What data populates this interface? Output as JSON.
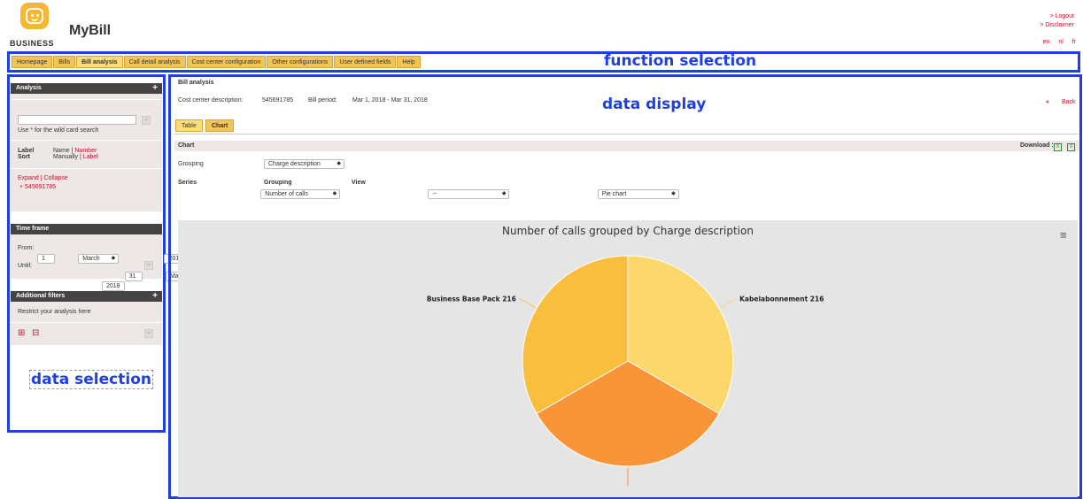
{
  "header": {
    "app_title": "MyBill",
    "brand_sub": "BUSINESS",
    "logout": "> Logout",
    "disclaimer": "> Disclaimer",
    "languages": [
      "en",
      "nl",
      "fr"
    ]
  },
  "annotations": {
    "function_selection": "function selection",
    "data_display": "data display",
    "data_selection": "data selection"
  },
  "nav": [
    "Homepage",
    "Bills",
    "Bill analysis",
    "Call detail analysis",
    "Cost center configuration",
    "Other configurations",
    "User defined fields",
    "Help"
  ],
  "left": {
    "analysis": {
      "title": "Analysis",
      "search_hint": "Use * for the wild card search",
      "label_key": "Label",
      "label_name": "Name",
      "label_sep": " | ",
      "label_number": "Number",
      "sort_key": "Sort",
      "sort_manual": "Manually",
      "sort_label": "Label",
      "expand": "Expand",
      "collapse": "Collapse",
      "tree_item": "+ 545691785"
    },
    "timeframe": {
      "title": "Time frame",
      "from_label": "From:",
      "from_day": "1",
      "from_month": "March",
      "from_year": "2018",
      "until_label": "Until:",
      "until_day": "31",
      "until_month": "March",
      "until_year": "2018"
    },
    "filters": {
      "title": "Additional filters",
      "restrict": "Restrict your analysis here"
    }
  },
  "main": {
    "title": "Bill analysis",
    "cc_label": "Cost center description:",
    "cc_value": "545691785",
    "period_label": "Bill period:",
    "period_value": "Mar 1, 2018 - Mar 31, 2018",
    "back": "Back",
    "tabs": [
      "Table",
      "Chart"
    ],
    "chart_section": "Chart",
    "download": "Download :",
    "grouping_label": "Grouping",
    "grouping_value": "Charge description",
    "series_label": "Series",
    "series_value": "Number of calls",
    "grouping2_label": "Grouping",
    "grouping2_value": "--",
    "view_label": "View",
    "view_value": "Pie chart"
  },
  "chart_data": {
    "type": "pie",
    "title": "Number of calls grouped by Charge description",
    "categories": [
      "Kabelabonnement",
      "",
      "Business Base Pack"
    ],
    "values": [
      216,
      216,
      216
    ],
    "data_labels": [
      "Kabelabonnement 216",
      "",
      "Business Base Pack 216"
    ],
    "colors": [
      "#fcd76c",
      "#f79538",
      "#f9be3e"
    ]
  }
}
